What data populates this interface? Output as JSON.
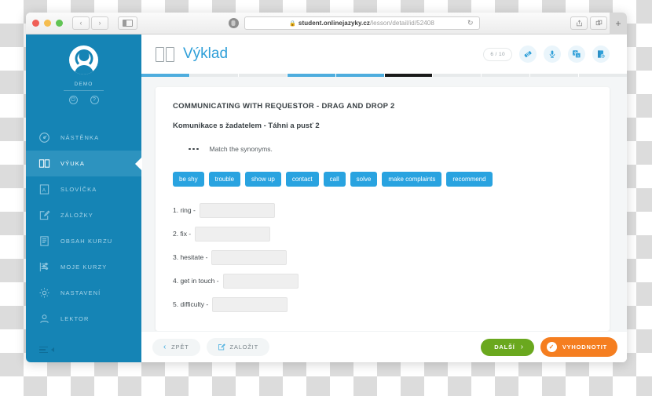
{
  "browser": {
    "url_prefix": "student.onlinejazyky.cz",
    "url_suffix": "/lesson/detail/id/52408",
    "lock_icon": "lock-icon",
    "reload_icon": "reload-icon",
    "back_icon": "‹",
    "forward_icon": "›",
    "new_tab_icon": "+"
  },
  "sidebar": {
    "account_label": "DEMO",
    "items": [
      {
        "label": "NÁSTĚNKA",
        "icon": "dashboard-icon"
      },
      {
        "label": "VÝUKA",
        "icon": "book-icon"
      },
      {
        "label": "SLOVÍČKA",
        "icon": "vocabulary-icon"
      },
      {
        "label": "ZÁLOŽKY",
        "icon": "bookmark-icon"
      },
      {
        "label": "OBSAH KURZU",
        "icon": "course-content-icon"
      },
      {
        "label": "MOJE KURZY",
        "icon": "my-courses-icon"
      },
      {
        "label": "NASTAVENÍ",
        "icon": "gear-icon"
      },
      {
        "label": "LEKTOR",
        "icon": "tutor-icon"
      }
    ],
    "active_index": 1,
    "power_icon": "⏻",
    "help_icon": "?"
  },
  "header": {
    "title": "Výklad",
    "book_icon": "book-icon",
    "progress_counter": "6 / 10",
    "tools": [
      {
        "name": "eraser-icon"
      },
      {
        "name": "microphone-icon"
      },
      {
        "name": "translate-icon"
      },
      {
        "name": "dictionary-add-icon"
      }
    ]
  },
  "progress": {
    "segments": [
      "done",
      "todo",
      "todo",
      "done",
      "done",
      "current",
      "todo",
      "todo",
      "todo",
      "todo"
    ]
  },
  "exercise": {
    "title": "COMMUNICATING WITH REQUESTOR - DRAG AND DROP 2",
    "subtitle": "Komunikace s žadatelem - Táhni a pusť 2",
    "instruction": "Match the synonyms.",
    "tags": [
      "be shy",
      "trouble",
      "show up",
      "contact",
      "call",
      "solve",
      "make complaints",
      "recommend"
    ],
    "answers": [
      {
        "label": "1. ring -",
        "value": ""
      },
      {
        "label": "2. fix -",
        "value": ""
      },
      {
        "label": "3. hesitate -",
        "value": ""
      },
      {
        "label": "4. get in touch -",
        "value": ""
      },
      {
        "label": "5. difficulty -",
        "value": ""
      }
    ]
  },
  "footer": {
    "back_label": "ZPĚT",
    "bookmark_label": "ZALOŽIT",
    "next_label": "DALŠÍ",
    "evaluate_label": "VYHODNOTIT",
    "next_arrow": "›",
    "back_arrow": "‹",
    "check_mark": "✓"
  },
  "colors": {
    "sidebar": "#1584b5",
    "accent_blue": "#2f9fd8",
    "tag_blue": "#29a3e0",
    "green": "#6aa81e",
    "orange": "#f57e20",
    "current_segment": "#1a1a1a"
  }
}
